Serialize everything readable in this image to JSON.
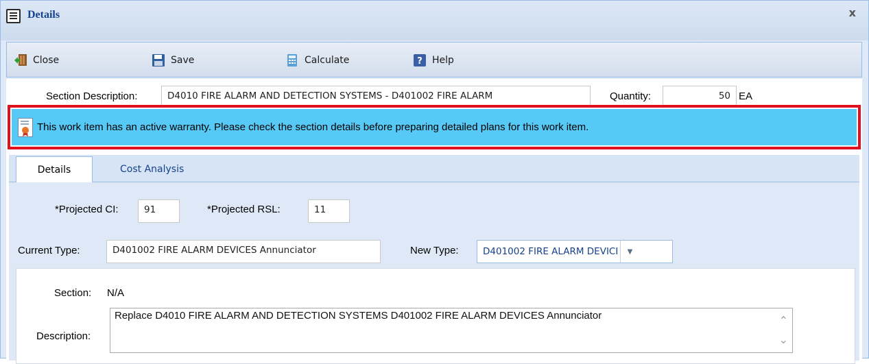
{
  "window": {
    "title": "Details",
    "close_glyph": "x"
  },
  "toolbar": {
    "close_label": "Close",
    "save_label": "Save",
    "calculate_label": "Calculate",
    "help_label": "Help"
  },
  "section_description": {
    "label": "Section Description:",
    "value": "D4010 FIRE ALARM AND DETECTION SYSTEMS - D401002 FIRE ALARM"
  },
  "quantity": {
    "label": "Quantity:",
    "value": "50",
    "unit": "EA"
  },
  "warning": {
    "text": "This work item has an active warranty.  Please check the section details before preparing detailed plans for this work item.",
    "background": "#56c9f6",
    "outline_color": "#e0101e",
    "icon": "certificate-icon"
  },
  "tabs": [
    {
      "label": "Details",
      "active": true
    },
    {
      "label": "Cost Analysis",
      "active": false
    }
  ],
  "details": {
    "projected_ci_label": "*Projected CI:",
    "projected_ci_value": "91",
    "projected_rsl_label": "*Projected RSL:",
    "projected_rsl_value": "11",
    "current_type_label": "Current Type:",
    "current_type_value": "D401002 FIRE ALARM DEVICES Annunciator",
    "new_type_label": "New Type:",
    "new_type_value": "D401002 FIRE ALARM DEVICI",
    "section_label": "Section:",
    "section_value": "N/A",
    "description_label": "Description:",
    "description_value": "Replace D4010 FIRE ALARM AND DETECTION SYSTEMS D401002 FIRE ALARM DEVICES Annunciator"
  }
}
